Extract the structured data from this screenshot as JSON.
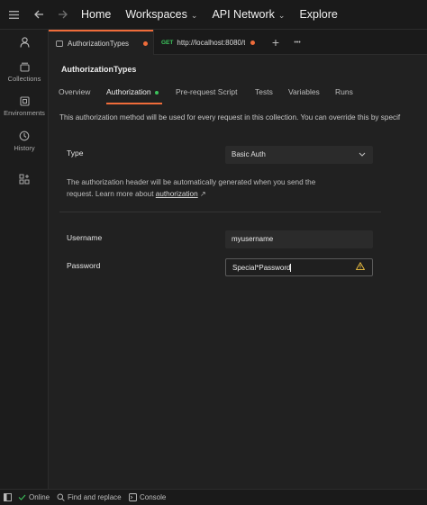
{
  "header": {
    "home": "Home",
    "workspaces": "Workspaces",
    "api_network": "API Network",
    "explore": "Explore"
  },
  "sidebar": {
    "items": [
      {
        "label": "Collections"
      },
      {
        "label": "Environments"
      },
      {
        "label": "History"
      }
    ]
  },
  "tabs": {
    "collection_tab": "AuthorizationTypes",
    "request_method": "GET",
    "request_url": "http://localhost:8080/t",
    "add_label": "+",
    "more_label": "•••"
  },
  "collection": {
    "title": "AuthorizationTypes",
    "subtabs": [
      "Overview",
      "Authorization",
      "Pre-request Script",
      "Tests",
      "Variables",
      "Runs"
    ],
    "active_subtab": "Authorization",
    "info_text": "This authorization method will be used for every request in this collection. You can override this by specif"
  },
  "auth": {
    "type_label": "Type",
    "type_value": "Basic Auth",
    "help_line1": "The authorization header will be automatically generated when you send the",
    "help_line2_prefix": "request. Learn more about ",
    "help_link": "authorization",
    "help_arrow": "↗",
    "username_label": "Username",
    "username_value": "myusername",
    "password_label": "Password",
    "password_value": "Special*Password"
  },
  "footer": {
    "online": "Online",
    "find_replace": "Find and replace",
    "console": "Console"
  },
  "colors": {
    "accent": "#ef6c3a",
    "online": "#3cc35c",
    "warning": "#f4c542"
  },
  "icons": [
    "menu-icon",
    "back-arrow-icon",
    "forward-arrow-icon",
    "chevron-down-icon",
    "user-icon",
    "collections-icon",
    "environments-icon",
    "history-icon",
    "new-widget-icon",
    "collection-tab-icon",
    "warning-icon",
    "sidebar-toggle-icon",
    "find-replace-icon",
    "console-icon"
  ]
}
